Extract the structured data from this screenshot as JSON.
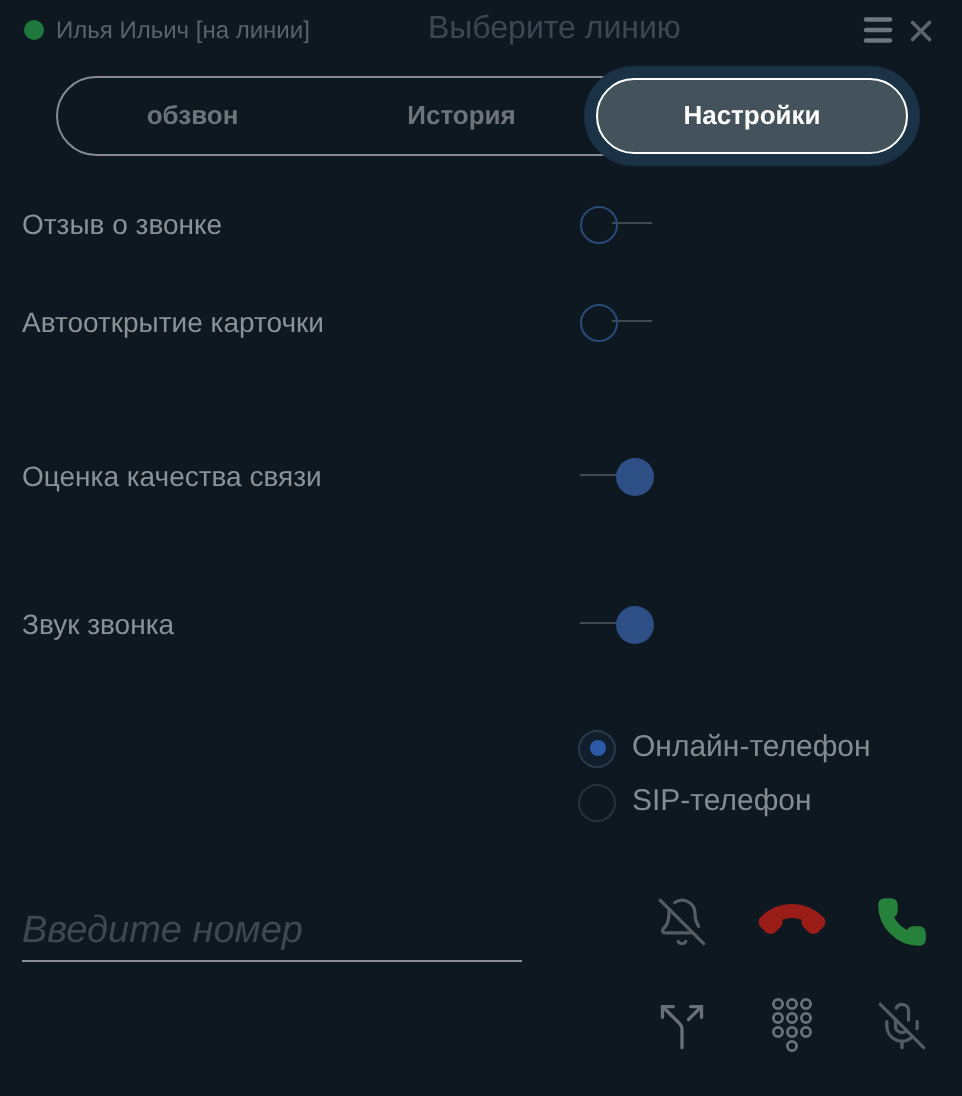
{
  "header": {
    "status": {
      "label": "Илья Ильич [на линии]",
      "color": "#1e7a3c"
    },
    "title": "Выберите линию"
  },
  "tabs": [
    {
      "label": "обзвон",
      "selected": false
    },
    {
      "label": "История",
      "selected": false
    },
    {
      "label": "Настройки",
      "selected": true
    }
  ],
  "settings": [
    {
      "label": "Отзыв о звонке",
      "on": false
    },
    {
      "label": "Автооткрытие карточки",
      "on": false
    },
    {
      "label": "Оценка качества связи",
      "on": true
    },
    {
      "label": "Звук звонка",
      "on": true
    }
  ],
  "phone_modes": [
    {
      "label": "Онлайн-телефон",
      "selected": true
    },
    {
      "label": "SIP-телефон",
      "selected": false
    }
  ],
  "number_field": {
    "placeholder": "Введите номер"
  }
}
